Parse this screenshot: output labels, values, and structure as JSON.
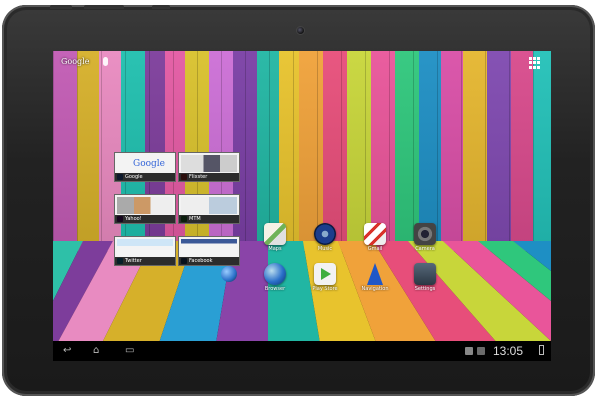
{
  "launcher": {
    "search_label": "Google"
  },
  "recent_apps": [
    {
      "title": "Google",
      "icon_color": "#4a8bf5"
    },
    {
      "title": "Flixster",
      "icon_color": "#e74c3c"
    },
    {
      "title": "Yahoo!",
      "icon_color": "#7b1fa2"
    },
    {
      "title": "MTM",
      "icon_color": "#3fa84a"
    },
    {
      "title": "Twitter",
      "icon_color": "#2aa9e0"
    },
    {
      "title": "Facebook",
      "icon_color": "#3b5998"
    }
  ],
  "apps": [
    {
      "label": "Maps",
      "icon": "maps-icon",
      "color": "#6fb257"
    },
    {
      "label": "Music",
      "icon": "music-icon",
      "color": "#1c3d8c"
    },
    {
      "label": "Gmail",
      "icon": "gmail-icon",
      "color": "#e8e8e8"
    },
    {
      "label": "Camera",
      "icon": "camera-icon",
      "color": "#444"
    },
    {
      "label": "Browser",
      "icon": "browser-globe-icon",
      "color": "#2a6fc9"
    },
    {
      "label": "Play Store",
      "icon": "play-store-icon",
      "color": "#f2f2f2"
    },
    {
      "label": "Navigation",
      "icon": "navigation-icon",
      "color": "#1f57c7"
    },
    {
      "label": "Settings",
      "icon": "settings-icon",
      "color": "#3c4a57"
    }
  ],
  "navbar": {
    "back_glyph": "↩",
    "home_glyph": "⌂",
    "recents_glyph": "▭",
    "time": "13:05"
  }
}
